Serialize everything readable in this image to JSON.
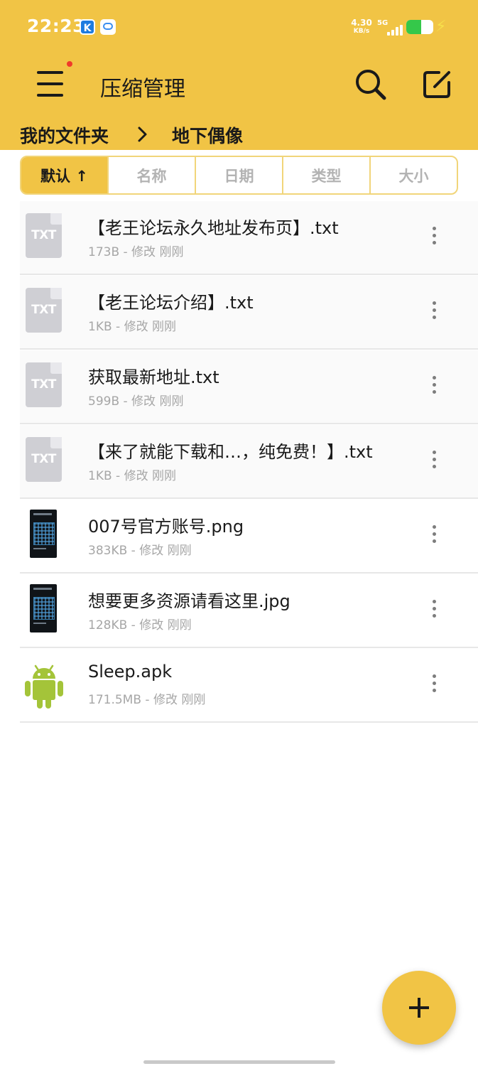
{
  "status_bar": {
    "time": "22:23",
    "app_icon_k": "K",
    "net_speed": "4.30",
    "net_unit": "KB/s",
    "network": "5G",
    "battery_level": 0.55,
    "battery_color": "#35c84a"
  },
  "app_bar": {
    "title": "压缩管理",
    "menu_icon": "hamburger-menu-icon",
    "search_icon": "search-icon",
    "edit_icon": "edit-icon",
    "accent_color": "#f1c445"
  },
  "breadcrumb": {
    "items": [
      "我的文件夹",
      "地下偶像"
    ],
    "separator_icon": "chevron-right-icon"
  },
  "sort_tabs": [
    {
      "label": "默认 ↑",
      "active": true
    },
    {
      "label": "名称",
      "active": false
    },
    {
      "label": "日期",
      "active": false
    },
    {
      "label": "类型",
      "active": false
    },
    {
      "label": "大小",
      "active": false
    }
  ],
  "files": [
    {
      "name": "【老王论坛永久地址发布页】.txt",
      "meta": "173B - 修改 刚刚",
      "type": "txt",
      "icon_label": "TXT"
    },
    {
      "name": "【老王论坛介绍】.txt",
      "meta": "1KB - 修改 刚刚",
      "type": "txt",
      "icon_label": "TXT"
    },
    {
      "name": "获取最新地址.txt",
      "meta": "599B - 修改 刚刚",
      "type": "txt",
      "icon_label": "TXT"
    },
    {
      "name": "【来了就能下载和…，纯免费！】.txt",
      "meta": "1KB - 修改 刚刚",
      "type": "txt",
      "icon_label": "TXT"
    },
    {
      "name": "007号官方账号.png",
      "meta": "383KB - 修改 刚刚",
      "type": "image"
    },
    {
      "name": "想要更多资源请看这里.jpg",
      "meta": "128KB - 修改 刚刚",
      "type": "image"
    },
    {
      "name": "Sleep.apk",
      "meta": "171.5MB - 修改 刚刚",
      "type": "apk"
    }
  ],
  "fab": {
    "icon": "plus-icon"
  }
}
